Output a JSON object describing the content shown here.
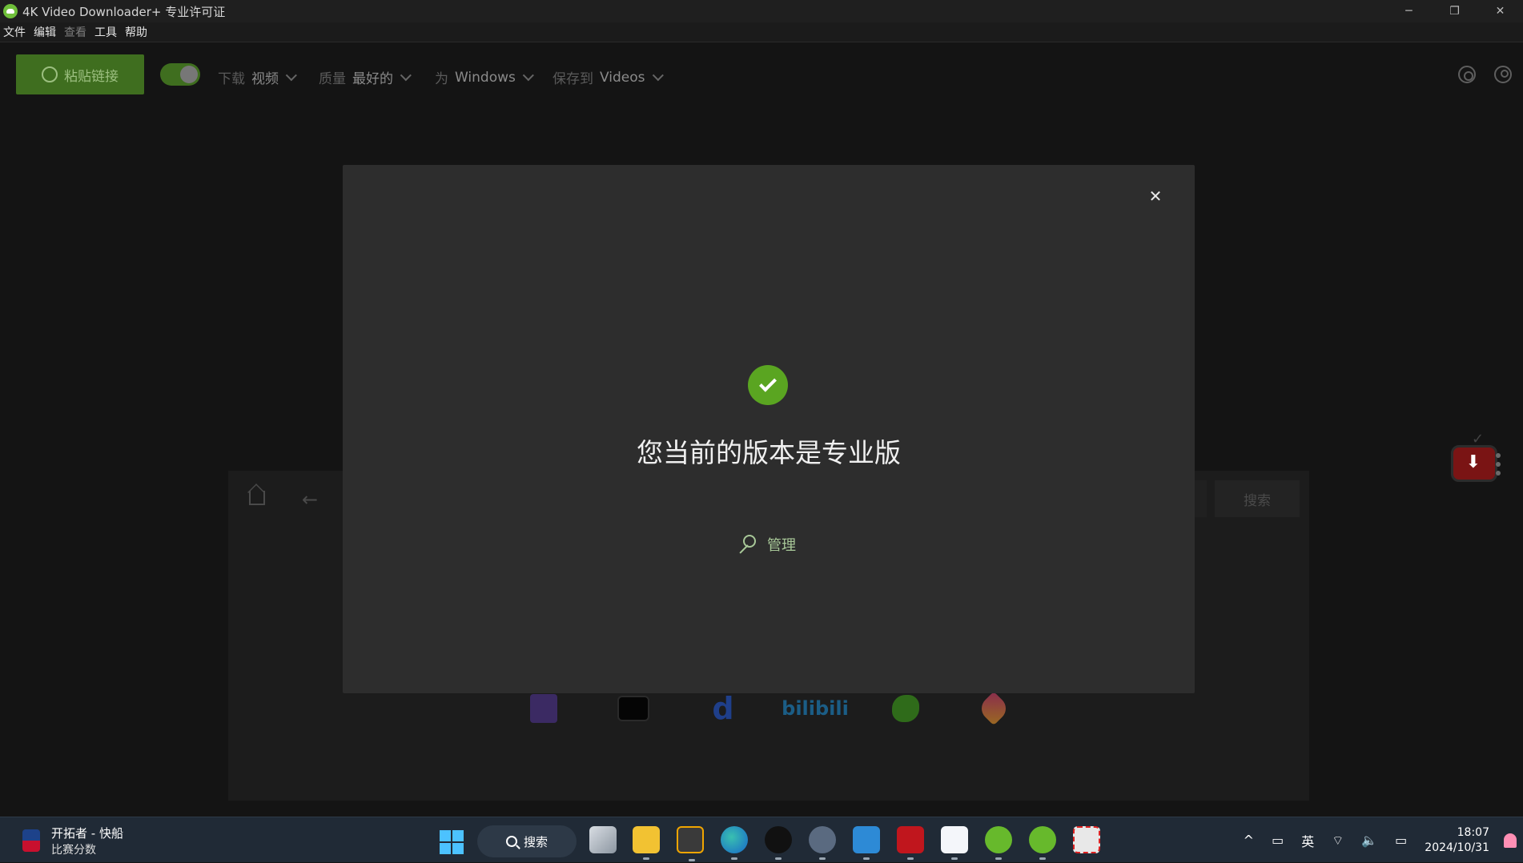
{
  "window": {
    "title": "4K Video Downloader+ 专业许可证",
    "controls": {
      "minimize": "─",
      "restore": "❐",
      "close": "✕"
    }
  },
  "menu": {
    "items": [
      {
        "label": "文件",
        "enabled": true
      },
      {
        "label": "编辑",
        "enabled": true
      },
      {
        "label": "查看",
        "enabled": false
      },
      {
        "label": "工具",
        "enabled": true
      },
      {
        "label": "帮助",
        "enabled": true
      }
    ]
  },
  "toolbar": {
    "paste_label": "粘贴链接",
    "download": {
      "label": "下载",
      "value": "视频"
    },
    "quality": {
      "label": "质量",
      "value": "最好的"
    },
    "for": {
      "label": "为",
      "value": "Windows"
    },
    "save_to": {
      "label": "保存到",
      "value": "Videos"
    }
  },
  "browser": {
    "search_label": "搜索",
    "back_glyph": "←",
    "sites": [
      {
        "name": "twitch-icon"
      },
      {
        "name": "tv-icon"
      },
      {
        "name": "dailymotion-icon",
        "glyph": "d"
      },
      {
        "name": "bilibili-icon",
        "glyph": "bilibili"
      },
      {
        "name": "rumble-icon"
      },
      {
        "name": "likee-icon"
      }
    ]
  },
  "modal": {
    "heading": "您当前的版本是专业版",
    "manage_label": "管理",
    "close_glyph": "✕",
    "accent": "#5aa521"
  },
  "taskbar": {
    "widget": {
      "title": "开拓者 - 快船",
      "subtitle": "比赛分数"
    },
    "search_label": "搜索",
    "tray": {
      "chevron": "^",
      "ime": "英",
      "time": "18:07",
      "date": "2024/10/31"
    }
  }
}
